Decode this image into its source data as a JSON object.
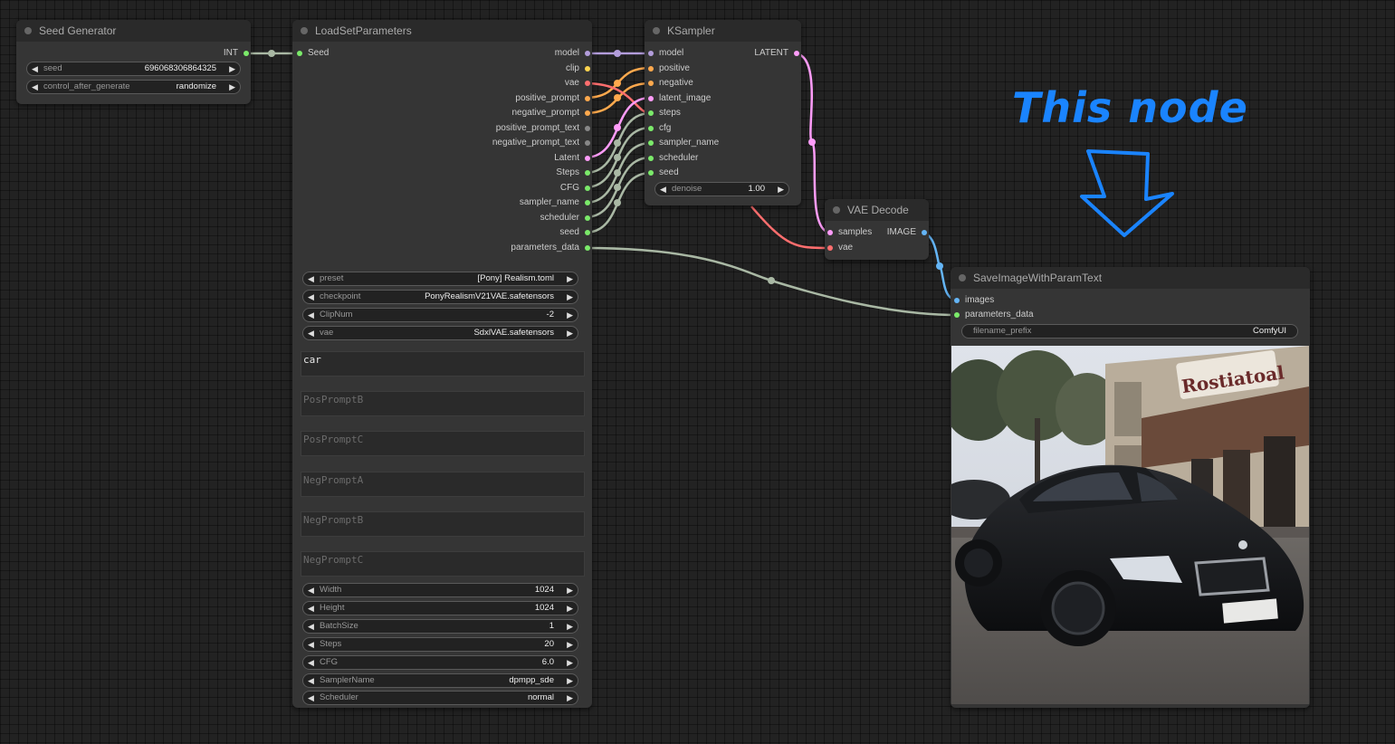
{
  "seed_generator": {
    "title": "Seed Generator",
    "output_label": "INT",
    "widgets": [
      {
        "label": "seed",
        "value": "696068306864325"
      },
      {
        "label": "control_after_generate",
        "value": "randomize"
      }
    ]
  },
  "load_set_parameters": {
    "title": "LoadSetParameters",
    "input_label": "Seed",
    "outputs": [
      "model",
      "clip",
      "vae",
      "positive_prompt",
      "negative_prompt",
      "positive_prompt_text",
      "negative_prompt_text",
      "Latent",
      "Steps",
      "CFG",
      "sampler_name",
      "scheduler",
      "seed",
      "parameters_data"
    ],
    "widgets_top": [
      {
        "label": "preset",
        "value": "[Pony] Realism.toml"
      },
      {
        "label": "checkpoint",
        "value": "PonyRealismV21VAE.safetensors"
      },
      {
        "label": "ClipNum",
        "value": "-2"
      },
      {
        "label": "vae",
        "value": "SdxlVAE.safetensors"
      }
    ],
    "textareas": [
      {
        "value": "car",
        "placeholder": ""
      },
      {
        "value": "",
        "placeholder": "PosPromptB"
      },
      {
        "value": "",
        "placeholder": "PosPromptC"
      },
      {
        "value": "",
        "placeholder": "NegPromptA"
      },
      {
        "value": "",
        "placeholder": "NegPromptB"
      },
      {
        "value": "",
        "placeholder": "NegPromptC"
      }
    ],
    "widgets_bottom": [
      {
        "label": "Width",
        "value": "1024"
      },
      {
        "label": "Height",
        "value": "1024"
      },
      {
        "label": "BatchSize",
        "value": "1"
      },
      {
        "label": "Steps",
        "value": "20"
      },
      {
        "label": "CFG",
        "value": "6.0"
      },
      {
        "label": "SamplerName",
        "value": "dpmpp_sde"
      },
      {
        "label": "Scheduler",
        "value": "normal"
      }
    ]
  },
  "ksampler": {
    "title": "KSampler",
    "inputs": [
      "model",
      "positive",
      "negative",
      "latent_image",
      "steps",
      "cfg",
      "sampler_name",
      "scheduler",
      "seed"
    ],
    "output_label": "LATENT",
    "widget": {
      "label": "denoise",
      "value": "1.00"
    }
  },
  "vae_decode": {
    "title": "VAE Decode",
    "inputs": [
      "samples",
      "vae"
    ],
    "output_label": "IMAGE"
  },
  "save_image": {
    "title": "SaveImageWithParamText",
    "inputs": [
      "images",
      "parameters_data"
    ],
    "widget": {
      "label": "filename_prefix",
      "value": "ComfyUI"
    },
    "sign_text": "Rostiatoal"
  },
  "annotation": {
    "text": "This node",
    "arrow": "down-arrow"
  },
  "colors": {
    "model": "#b39ddb",
    "clip": "#ffd54f",
    "vae": "#ff6e6e",
    "conditioning": "#ffa94d",
    "latent": "#ff9cf9",
    "int": "#7bea6a",
    "image": "#64b5f6",
    "link_default": "#a9b8a4"
  }
}
